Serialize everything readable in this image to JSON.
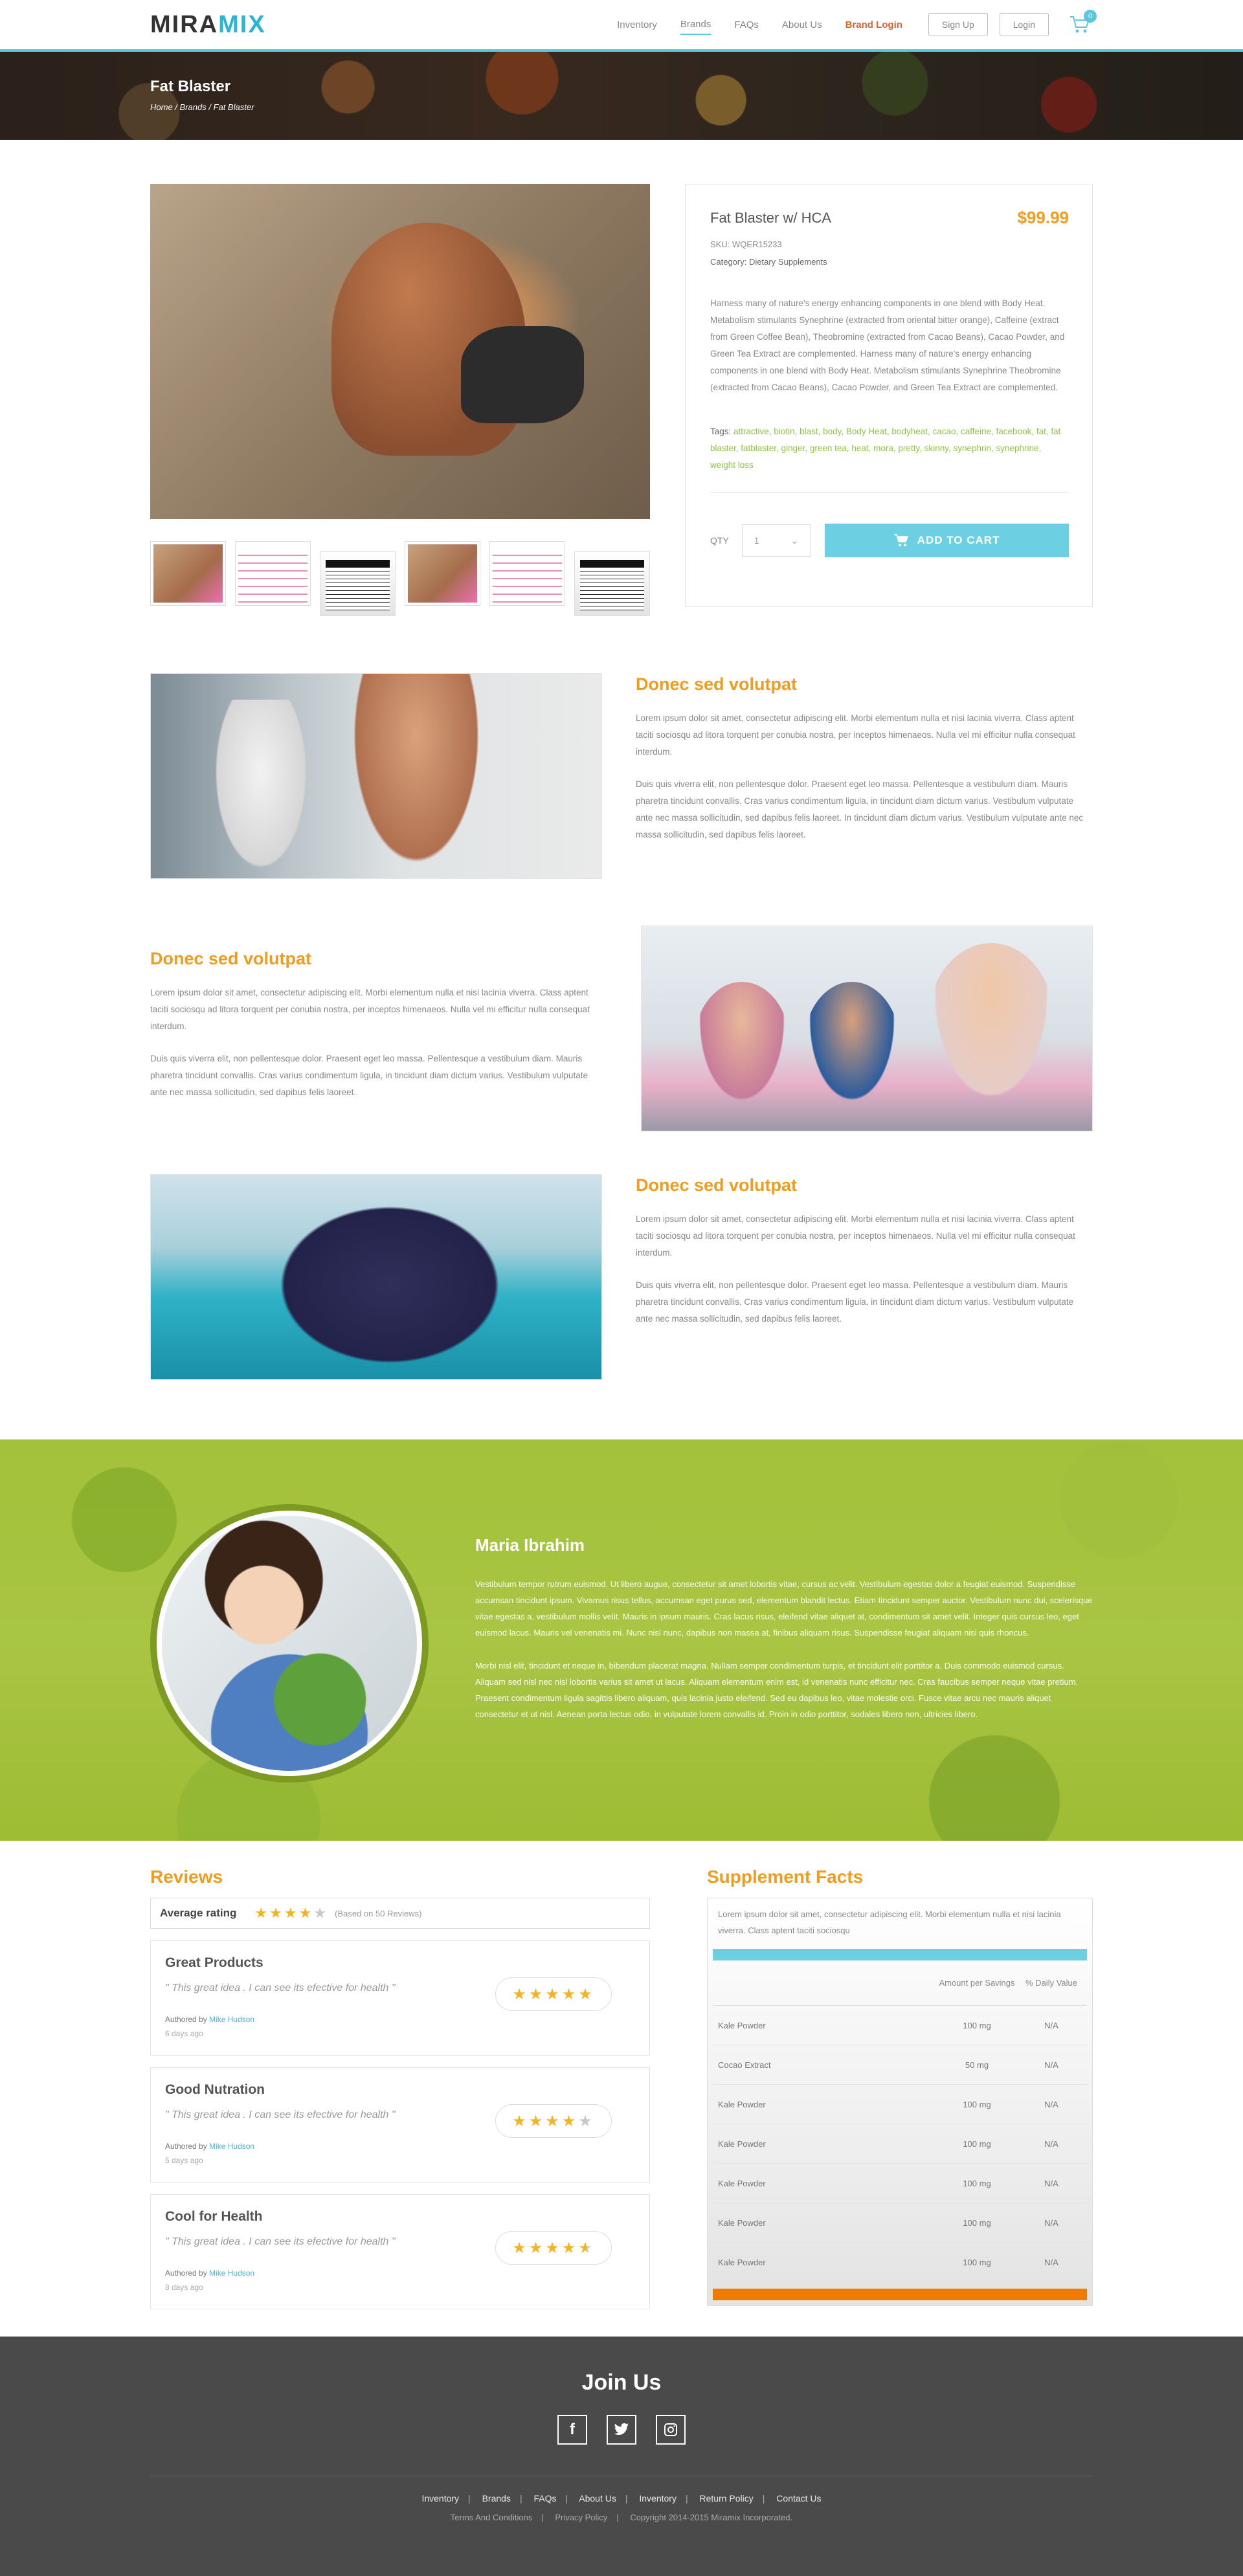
{
  "header": {
    "logo_a": "MIRA",
    "logo_b": "MIX",
    "nav": [
      "Inventory",
      "Brands",
      "FAQs",
      "About Us",
      "Brand Login"
    ],
    "signup": "Sign Up",
    "login": "Login",
    "cart_count": "0",
    "accent": "#5cc8dc"
  },
  "hero": {
    "title": "Fat Blaster",
    "breadcrumb": "Home / Brands / Fat Blaster"
  },
  "product": {
    "name": "Fat Blaster w/ HCA",
    "price": "$99.99",
    "sku_label": "SKU:",
    "sku": "WQER15233",
    "category_label": "Category:",
    "category": "Dietary Supplements",
    "description": "Harness many of nature's energy enhancing components in one blend with Body Heat. Metabolism stimulants Synephrine (extracted from oriental bitter orange), Caffeine (extract from Green Coffee Bean), Theobromine (extracted from Cacao Beans), Cacao Powder, and Green Tea Extract are complemented. Harness many of nature's energy enhancing components in one blend with Body Heat. Metabolism stimulants Synephrine  Theobromine (extracted from Cacao Beans), Cacao Powder, and Green Tea Extract are complemented.",
    "tags_label": "Tags:",
    "tags": "attractive, biotin, blast, body, Body Heat, bodyheat, cacao, caffeine, facebook, fat, fat blaster, fatblaster, ginger, green tea, heat, mora, pretty, skinny, synephrin, synephrine, weight loss",
    "qty_label": "QTY",
    "qty_value": "1",
    "add_to_cart": "ADD TO CART",
    "price_color": "#f29c1f"
  },
  "features": [
    {
      "title": "Donec sed volutpat",
      "p1": "Lorem ipsum dolor sit amet, consectetur adipiscing elit. Morbi elementum nulla et nisi lacinia viverra. Class aptent taciti sociosqu ad litora torquent per conubia nostra, per inceptos himenaeos. Nulla vel mi efficitur nulla consequat interdum.",
      "p2": "Duis quis viverra elit, non pellentesque dolor. Praesent eget leo massa. Pellentesque a vestibulum diam. Mauris pharetra tincidunt convallis. Cras varius condimentum ligula, in tincidunt diam dictum varius. Vestibulum vulputate ante nec massa sollicitudin, sed dapibus felis laoreet.  In tincidunt diam dictum varius. Vestibulum vulputate ante nec massa sollicitudin, sed dapibus felis laoreet."
    },
    {
      "title": "Donec sed volutpat",
      "p1": "Lorem ipsum dolor sit amet, consectetur adipiscing elit. Morbi elementum nulla et nisi lacinia viverra. Class aptent taciti sociosqu ad litora torquent per conubia nostra, per inceptos himenaeos. Nulla vel mi efficitur nulla consequat interdum.",
      "p2": "Duis quis viverra elit, non pellentesque dolor. Praesent eget leo massa. Pellentesque a vestibulum diam. Mauris pharetra tincidunt convallis. Cras varius condimentum ligula, in tincidunt diam dictum varius. Vestibulum vulputate ante nec massa sollicitudin, sed dapibus felis laoreet."
    },
    {
      "title": "Donec sed volutpat",
      "p1": "Lorem ipsum dolor sit amet, consectetur adipiscing elit. Morbi elementum nulla et nisi lacinia viverra. Class aptent taciti sociosqu ad litora torquent per conubia nostra, per inceptos himenaeos. Nulla vel mi efficitur nulla consequat interdum.",
      "p2": "Duis quis viverra elit, non pellentesque dolor. Praesent eget leo massa. Pellentesque a vestibulum diam. Mauris pharetra tincidunt convallis. Cras varius condimentum ligula, in tincidunt diam dictum varius. Vestibulum vulputate ante nec massa sollicitudin, sed dapibus felis laoreet."
    }
  ],
  "testimonial": {
    "name": "Maria Ibrahim",
    "p1": "Vestibulum tempor rutrum euismod. Ut libero augue, consectetur sit amet lobortis vitae, cursus ac velit. Vestibulum egestas dolor a feugiat euismod. Suspendisse accumsan tincidunt ipsum. Vivamus risus tellus, accumsan eget purus sed, elementum blandit lectus. Etiam tincidunt semper auctor. Vestibulum nunc dui, scelerisque vitae egestas a, vestibulum mollis velit. Mauris in ipsum mauris. Cras lacus risus, eleifend vitae aliquet at, condimentum sit amet velit. Integer quis cursus leo, eget euismod lacus. Mauris vel venenatis mi. Nunc nisl nunc, dapibus non massa at, finibus aliquam risus. Suspendisse feugiat aliquam nisi quis rhoncus.",
    "p2": "Morbi nisl elit, tincidunt et neque in, bibendum placerat magna. Nullam semper condimentum turpis, et tincidunt elit porttitor a. Duis commodo euismod cursus. Aliquam sed nisl nec nisl lobortis varius sit amet ut lacus. Aliquam elementum enim est, id venenatis nunc efficitur nec. Cras faucibus semper neque vitae pretium. Praesent condimentum ligula sagittis libero aliquam, quis lacinia justo eleifend. Sed eu dapibus leo, vitae molestie orci. Fusce vitae arcu nec mauris aliquet consectetur et ut nisl. Aenean porta lectus odio, in vulputate lorem convallis id. Proin in odio porttitor, sodales libero non, ultricies libero."
  },
  "reviews": {
    "title": "Reviews",
    "avg_label": "Average rating",
    "avg_rating": 4,
    "avg_note": "(Based on 50  Reviews)",
    "items": [
      {
        "title": "Great Products",
        "quote": "\" This great idea . I can see  its efective for health  \"",
        "by_label": "Authored by",
        "author": "Mike Hudson",
        "date": "6 days ago",
        "rating": 5
      },
      {
        "title": "Good Nutration",
        "quote": "\" This great idea . I can see  its efective for health  \"",
        "by_label": "Authored by",
        "author": "Mike Hudson",
        "date": "5 days ago",
        "rating": 4
      },
      {
        "title": "Cool for Health",
        "quote": "\" This great idea . I can see  its efective for health  \"",
        "by_label": "Authored by",
        "author": "Mike Hudson",
        "date": "8 days ago",
        "rating": 4.5
      }
    ]
  },
  "facts": {
    "title": "Supplement Facts",
    "intro": "Lorem ipsum dolor sit amet, consectetur adipiscing elit. Morbi elementum nulla et nisi lacinia viverra. Class aptent taciti sociosqu",
    "col_amount": "Amount per Savings",
    "col_dv": "% Daily Value",
    "rows": [
      {
        "name": "Kale Powder",
        "amount": "100 mg",
        "dv": "N/A"
      },
      {
        "name": "Cocao Extract",
        "amount": "50 mg",
        "dv": "N/A"
      },
      {
        "name": "Kale Powder",
        "amount": "100 mg",
        "dv": "N/A"
      },
      {
        "name": "Kale Powder",
        "amount": "100 mg",
        "dv": "N/A"
      },
      {
        "name": "Kale Powder",
        "amount": "100 mg",
        "dv": "N/A"
      },
      {
        "name": "Kale Powder",
        "amount": "100 mg",
        "dv": "N/A"
      },
      {
        "name": "Kale Powder",
        "amount": "100 mg",
        "dv": "N/A"
      }
    ],
    "top_bar_color": "#6dd0e2",
    "bottom_bar_color": "#f07b00"
  },
  "footer": {
    "join": "Join Us",
    "socials": [
      "facebook-icon",
      "twitter-icon",
      "instagram-icon"
    ],
    "links": [
      "Inventory",
      "Brands",
      "FAQs",
      "About Us",
      "Inventory",
      "Return Policy",
      "Contact Us"
    ],
    "sub": [
      "Terms And Conditions",
      "Privacy Policy",
      "Copyright 2014-2015 Miramix Incorporated."
    ]
  }
}
